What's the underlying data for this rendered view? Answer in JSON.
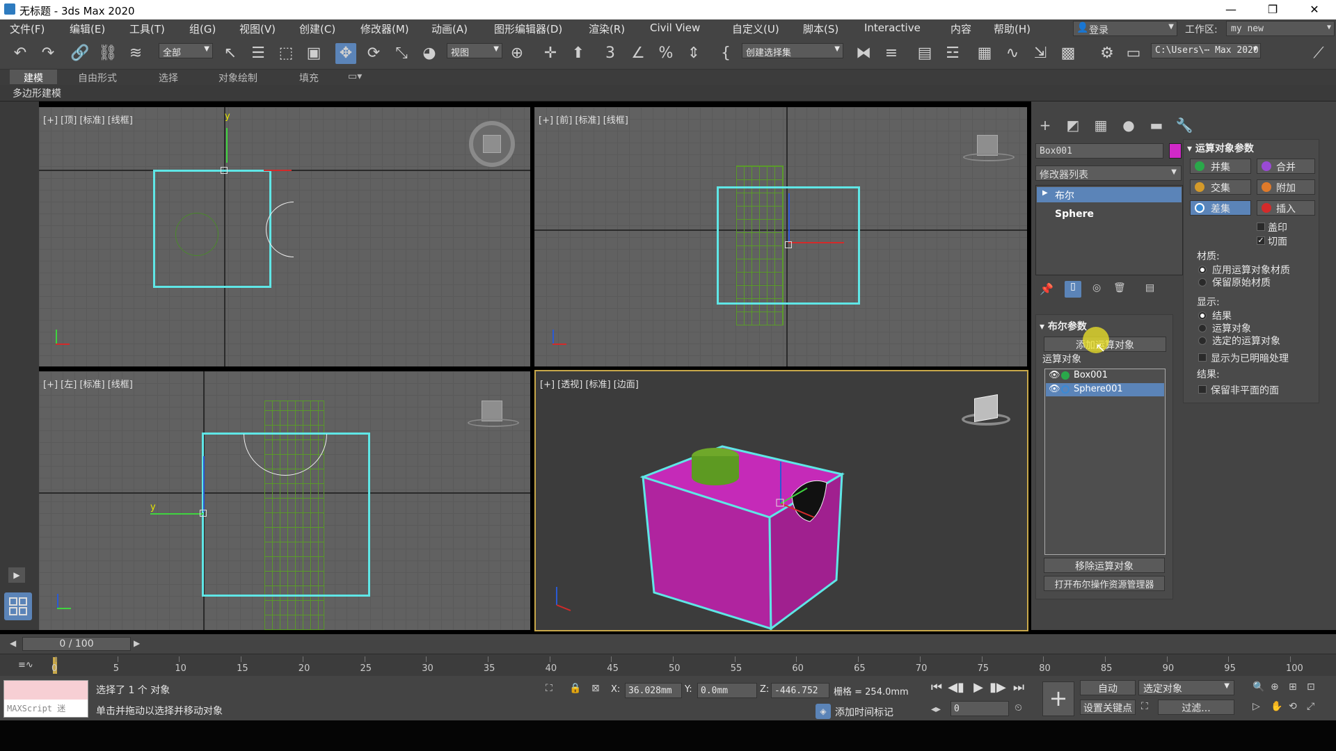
{
  "window": {
    "title": "无标题 - 3ds Max 2020",
    "minimize": "—",
    "maximize": "❐",
    "close": "✕"
  },
  "menu": [
    "文件(F)",
    "编辑(E)",
    "工具(T)",
    "组(G)",
    "视图(V)",
    "创建(C)",
    "修改器(M)",
    "动画(A)",
    "图形编辑器(D)",
    "渲染(R)",
    "Civil View",
    "自定义(U)",
    "脚本(S)",
    "Interactive",
    "内容",
    "帮助(H)"
  ],
  "login": "登录",
  "workspace": {
    "label": "工作区:",
    "value": "my new"
  },
  "toolbar": {
    "filter_select": "全部",
    "ref_coord": "视图",
    "named_sel": "创建选择集",
    "path": "C:\\Users\\⋯ Max 2020"
  },
  "ribbon": {
    "tabs": [
      "建模",
      "自由形式",
      "选择",
      "对象绘制",
      "填充"
    ],
    "active": "建模",
    "sub_label": "多边形建模"
  },
  "viewports": {
    "top": "[+] [顶] [标准] [线框]",
    "front": "[+] [前] [标准] [线框]",
    "left": "[+] [左] [标准] [线框]",
    "persp": "[+] [透视] [标准] [边面]"
  },
  "command_panel": {
    "object_name": "Box001",
    "object_color": "#d129c8",
    "modifier_list": "修改器列表",
    "stack": {
      "boolean": "布尔",
      "sphere": "Sphere"
    },
    "bool_params": {
      "title": "布尔参数",
      "add_operand": "添加运算对象",
      "operands_label": "运算对象",
      "operands": [
        "Box001",
        "Sphere001"
      ],
      "remove_operand": "移除运算对象",
      "open_explorer": "打开布尔操作资源管理器"
    },
    "operand_params": {
      "title": "运算对象参数",
      "union": "并集",
      "merge": "合并",
      "intersect": "交集",
      "attach": "附加",
      "subtract": "差集",
      "insert": "插入",
      "imprint": "盖印",
      "cut_face": "切面",
      "cut_face_checked": true,
      "material_label": "材质:",
      "mat_apply": "应用运算对象材质",
      "mat_keep": "保留原始材质",
      "display_label": "显示:",
      "disp_result": "结果",
      "disp_operands": "运算对象",
      "disp_selected": "选定的运算对象",
      "show_hidden": "显示为已明暗处理",
      "result_label": "结果:",
      "keep_nonplanar": "保留非平面的面"
    }
  },
  "timeline": {
    "slider": "0 / 100",
    "ticks": [
      "0",
      "5",
      "10",
      "15",
      "20",
      "25",
      "30",
      "35",
      "40",
      "45",
      "50",
      "55",
      "60",
      "65",
      "70",
      "75",
      "80",
      "85",
      "90",
      "95",
      "100"
    ]
  },
  "status": {
    "maxscript": "MAXScript 迷",
    "line1": "选择了 1 个 对象",
    "line2": "单击并拖动以选择并移动对象",
    "x_label": "X:",
    "x": "36.028mm",
    "y_label": "Y:",
    "y": "0.0mm",
    "z_label": "Z:",
    "z": "-446.752",
    "grid": "栅格 = 254.0mm",
    "add_time_tag": "添加时间标记",
    "auto": "自动",
    "selected_object": "选定对象",
    "set_key": "设置关键点",
    "filter": "过滤...",
    "frame": "0"
  }
}
